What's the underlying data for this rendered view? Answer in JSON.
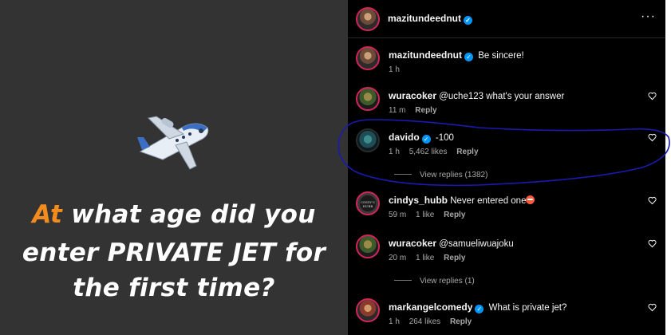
{
  "post": {
    "headline_line1_accent": "At",
    "headline_line1_rest": " what age did you",
    "headline_line2": "enter PRIVATE JET for",
    "headline_line3": "the first time?",
    "icon": "airplane-icon",
    "accent_color": "#f28c1e"
  },
  "header": {
    "username": "mazitundeednut",
    "more_label": "···"
  },
  "comments": [
    {
      "username": "mazitundeednut",
      "verified": true,
      "text": "Be sincere!",
      "time": "1 h"
    },
    {
      "username": "wuracoker",
      "text": "@uche123 what's your answer",
      "time": "11 m",
      "reply_label": "Reply"
    },
    {
      "username": "davido",
      "verified": true,
      "text": "-100",
      "time": "1 h",
      "likes": "5,462 likes",
      "reply_label": "Reply",
      "view_replies": "View replies (1382)"
    },
    {
      "username": "cindys_hubb",
      "text": "Never entered one",
      "emoji": "grimace-emoji",
      "time": "59 m",
      "likes": "1 like",
      "reply_label": "Reply",
      "avatar_text": "CINDY'S HUBB"
    },
    {
      "username": "wuracoker",
      "text": "@samueliwuajoku",
      "time": "20 m",
      "likes": "1 like",
      "reply_label": "Reply",
      "view_replies": "View replies (1)"
    },
    {
      "username": "markangelcomedy",
      "verified": true,
      "text": "What is private jet?",
      "time": "1 h",
      "likes": "264 likes",
      "reply_label": "Reply"
    }
  ],
  "annotation": {
    "color": "#1a1ab0"
  },
  "colors": {
    "verified": "#0095f6",
    "panel_bg": "#000000",
    "post_bg": "#333333"
  }
}
